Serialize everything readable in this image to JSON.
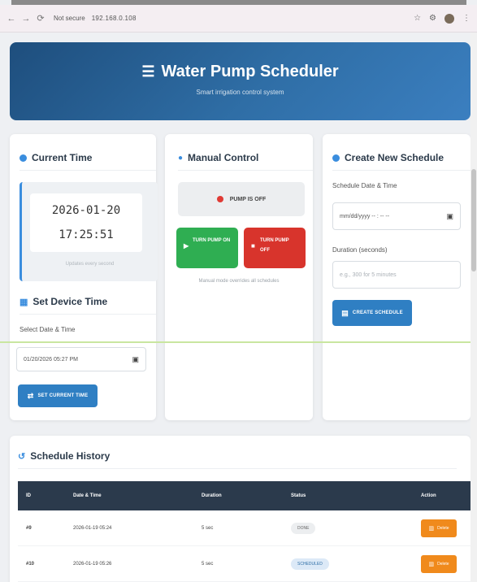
{
  "browser": {
    "nav": [
      "←",
      "→",
      "⟳"
    ],
    "security_label": "Not secure",
    "url": "192.168.0.108",
    "right_icons": [
      "☆",
      "⚙",
      "⋮"
    ]
  },
  "header": {
    "icon": "☰",
    "title": "Water Pump Scheduler",
    "subtitle": "Smart irrigation control system"
  },
  "current_time": {
    "heading": "Current Time",
    "date": "2026-01-20",
    "time": "17:25:51",
    "caption": "Updates every second"
  },
  "set_time": {
    "heading": "Set Device Time",
    "label": "Select Date & Time",
    "value": "01/20/2026 05:27 PM",
    "button": "SET CURRENT TIME"
  },
  "manual": {
    "heading": "Manual Control",
    "status": "PUMP IS OFF",
    "on_button": "TURN PUMP ON",
    "off_button": "TURN PUMP OFF",
    "note": "Manual mode overrides all schedules"
  },
  "create": {
    "heading": "Create New Schedule",
    "date_label": "Schedule Date & Time",
    "date_placeholder": "mm/dd/yyyy -- : -- --",
    "duration_label": "Duration (seconds)",
    "duration_placeholder": "e.g., 300 for 5 minutes",
    "button": "CREATE SCHEDULE"
  },
  "history": {
    "heading": "Schedule History",
    "columns": [
      "ID",
      "Date & Time",
      "Duration",
      "Status",
      "Action"
    ],
    "rows": [
      {
        "id": "#9",
        "datetime": "2026-01-19 05:24",
        "duration": "5 sec",
        "status": "DONE",
        "action": "Delete"
      },
      {
        "id": "#10",
        "datetime": "2026-01-19 05:26",
        "duration": "5 sec",
        "status": "SCHEDULED",
        "action": "Delete"
      }
    ]
  },
  "colors": {
    "header_gradient_start": "#1e4e7d",
    "header_gradient_end": "#3b7fc0",
    "accent": "#2f7fc3",
    "on_green": "#2fae52",
    "off_red": "#d8342c",
    "delete_orange": "#f08a1c",
    "table_header": "#2b3a4c"
  }
}
